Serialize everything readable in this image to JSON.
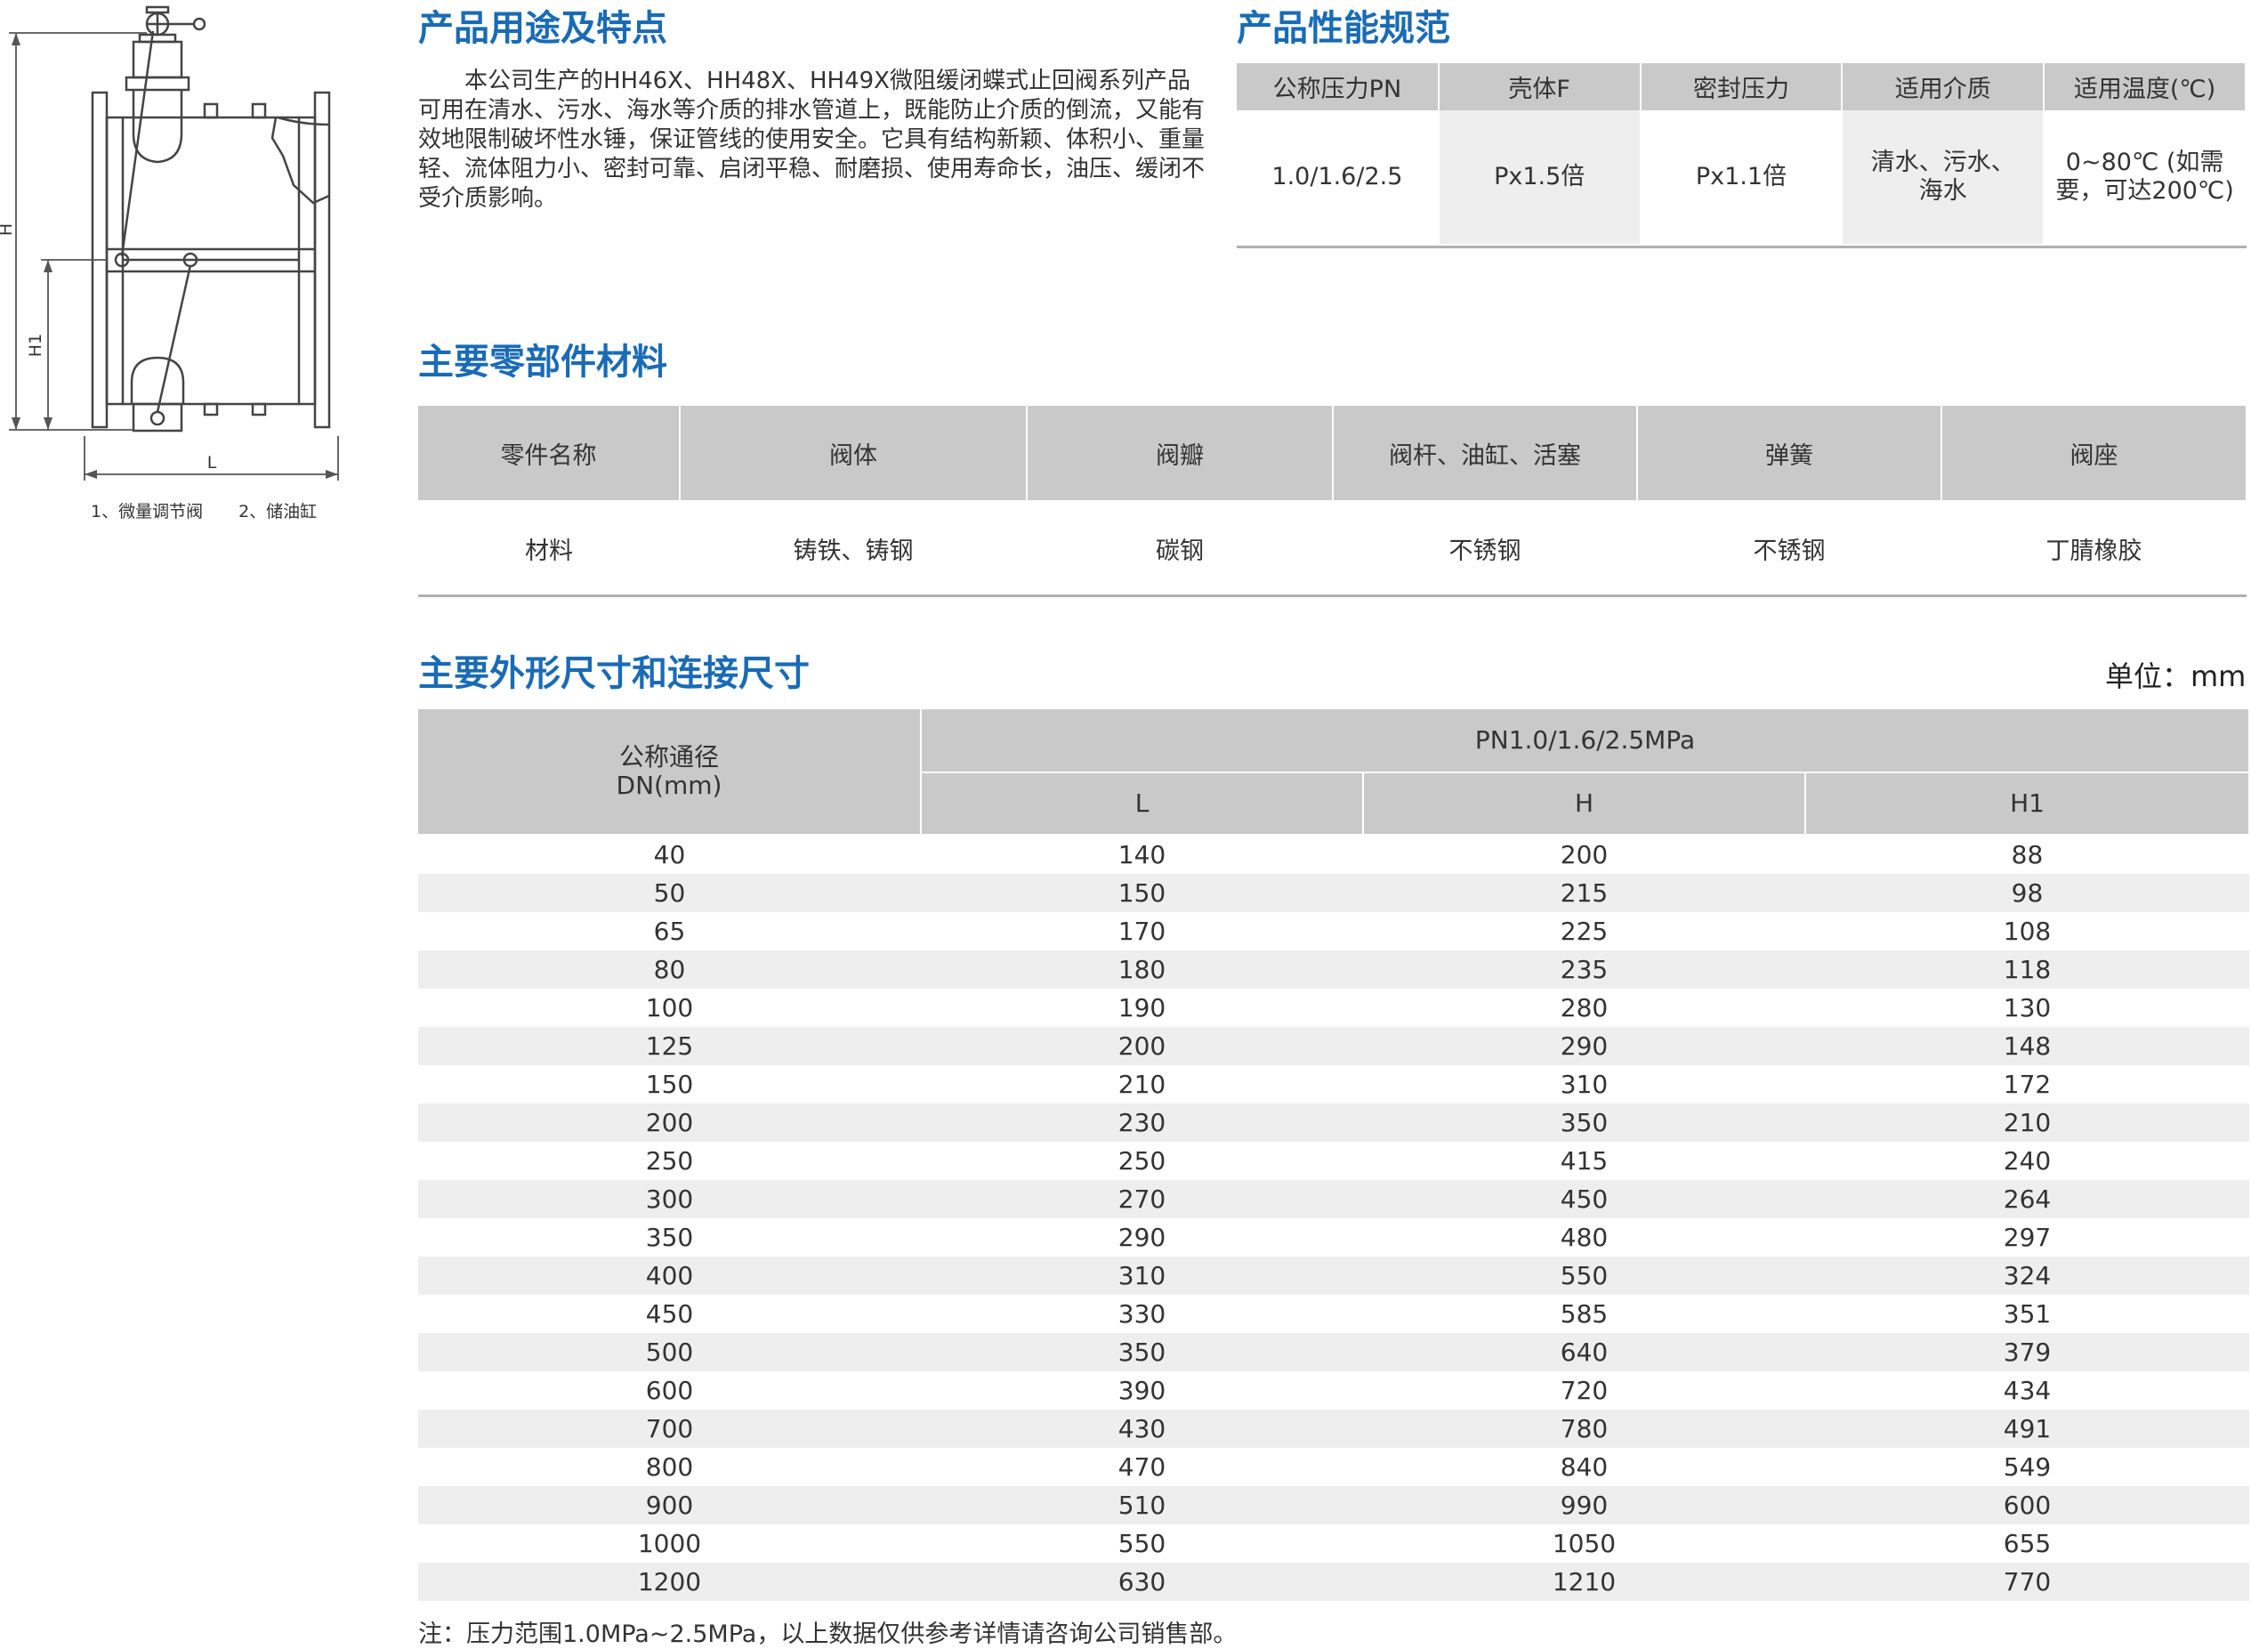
{
  "diagram": {
    "dim_labels": {
      "H": "H",
      "H1": "H1",
      "L": "L"
    },
    "captions": [
      "1、微量调节阀",
      "2、储油缸"
    ]
  },
  "intro": {
    "heading": "产品用途及特点",
    "text": "本公司生产的HH46X、HH48X、HH49X微阻缓闭蝶式止回阀系列产品可用在清水、污水、海水等介质的排水管道上，既能防止介质的倒流，又能有效地限制破坏性水锤，保证管线的使用安全。它具有结构新颖、体积小、重量轻、流体阻力小、密封可靠、启闭平稳、耐磨损、使用寿命长，油压、缓闭不受介质影响。"
  },
  "performance": {
    "heading": "产品性能规范",
    "headers": [
      "公称压力PN",
      "壳体F",
      "密封压力",
      "适用介质",
      "适用温度(℃)"
    ],
    "values": [
      "1.0/1.6/2.5",
      "Px1.5倍",
      "Px1.1倍",
      "清水、污水、海水",
      "0~80℃ (如需要，可达200℃)"
    ]
  },
  "materials": {
    "heading": "主要零部件材料",
    "headers": [
      "零件名称",
      "阀体",
      "阀瓣",
      "阀杆、油缸、活塞",
      "弹簧",
      "阀座"
    ],
    "values": [
      "材料",
      "铸铁、铸钢",
      "碳钢",
      "不锈钢",
      "不锈钢",
      "丁腈橡胶"
    ]
  },
  "dimensions": {
    "heading": "主要外形尺寸和连接尺寸",
    "unit": "单位：mm",
    "dn_header": "公称通径 DN(mm)",
    "pn_header": "PN1.0/1.6/2.5MPa",
    "columns": [
      "L",
      "H",
      "H1"
    ],
    "rows": [
      [
        "40",
        "140",
        "200",
        "88"
      ],
      [
        "50",
        "150",
        "215",
        "98"
      ],
      [
        "65",
        "170",
        "225",
        "108"
      ],
      [
        "80",
        "180",
        "235",
        "118"
      ],
      [
        "100",
        "190",
        "280",
        "130"
      ],
      [
        "125",
        "200",
        "290",
        "148"
      ],
      [
        "150",
        "210",
        "310",
        "172"
      ],
      [
        "200",
        "230",
        "350",
        "210"
      ],
      [
        "250",
        "250",
        "415",
        "240"
      ],
      [
        "300",
        "270",
        "450",
        "264"
      ],
      [
        "350",
        "290",
        "480",
        "297"
      ],
      [
        "400",
        "310",
        "550",
        "324"
      ],
      [
        "450",
        "330",
        "585",
        "351"
      ],
      [
        "500",
        "350",
        "640",
        "379"
      ],
      [
        "600",
        "390",
        "720",
        "434"
      ],
      [
        "700",
        "430",
        "780",
        "491"
      ],
      [
        "800",
        "470",
        "840",
        "549"
      ],
      [
        "900",
        "510",
        "990",
        "600"
      ],
      [
        "1000",
        "550",
        "1050",
        "655"
      ],
      [
        "1200",
        "630",
        "1210",
        "770"
      ]
    ],
    "note": "注：压力范围1.0MPa~2.5MPa，以上数据仅供参考详情请咨询公司销售部。"
  }
}
